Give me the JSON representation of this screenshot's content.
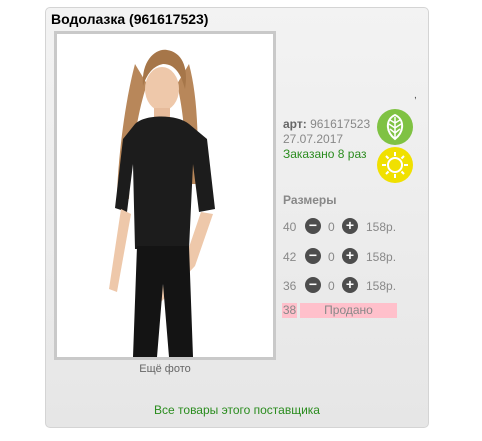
{
  "product": {
    "title": "Водолазка (961617523)",
    "art_label": "арт:",
    "art_number": "961617523",
    "date": "27.07.2017",
    "ordered_text": "Заказано 8 раз",
    "more_photos": "Ещё фото",
    "tick_mark": ","
  },
  "icons": {
    "leaf": "leaf-icon",
    "sun": "sun-icon",
    "leaf_color": "#7fc243",
    "sun_color": "#f0e000"
  },
  "sizes": {
    "title": "Размеры",
    "rows": [
      {
        "size": "40",
        "qty": "0",
        "price": "158р."
      },
      {
        "size": "42",
        "qty": "0",
        "price": "158р."
      },
      {
        "size": "36",
        "qty": "0",
        "price": "158р."
      }
    ],
    "sold_size": "38",
    "sold_text": "Продано",
    "minus_symbol": "−",
    "plus_symbol": "+"
  },
  "footer": {
    "supplier_link": "Все товары этого поставщика"
  },
  "colors": {
    "accent_green": "#2a8c1e",
    "sold_pink": "#ffc0cb"
  }
}
